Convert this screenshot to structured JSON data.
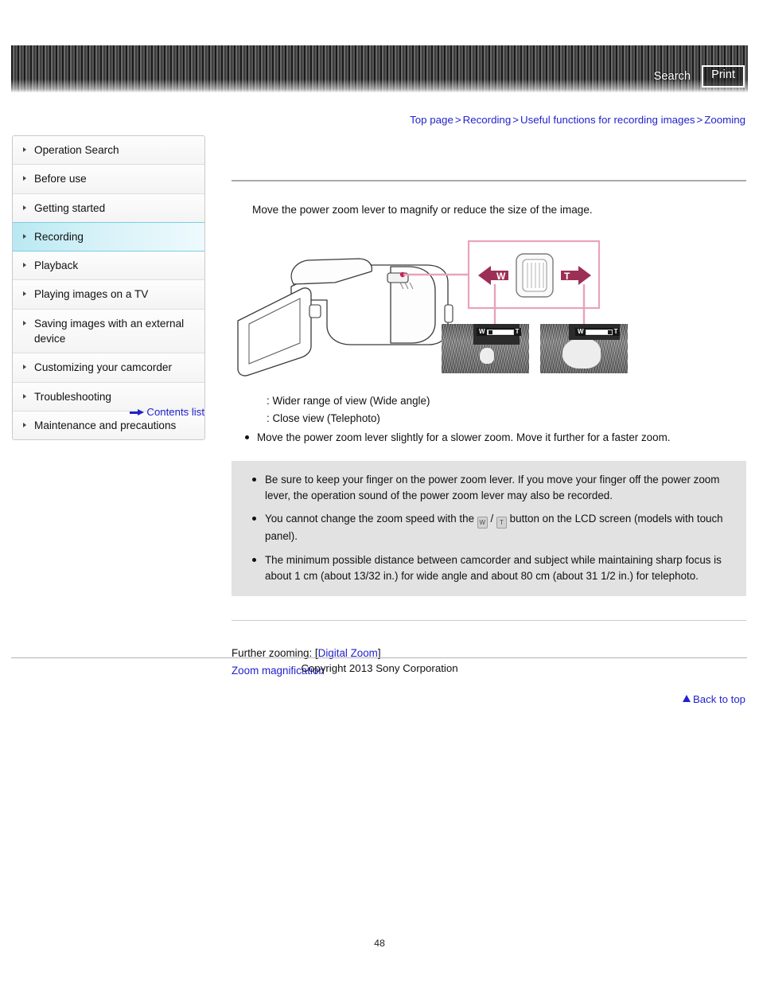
{
  "header": {
    "search_label": "Search",
    "print_label": "Print"
  },
  "breadcrumb": {
    "items": [
      "Top page",
      "Recording",
      "Useful functions for recording images",
      "Zooming"
    ],
    "separator": ">"
  },
  "sidebar": {
    "items": [
      {
        "label": "Operation Search",
        "active": false
      },
      {
        "label": "Before use",
        "active": false
      },
      {
        "label": "Getting started",
        "active": false
      },
      {
        "label": "Recording",
        "active": true
      },
      {
        "label": "Playback",
        "active": false
      },
      {
        "label": "Playing images on a TV",
        "active": false
      },
      {
        "label": "Saving images with an external device",
        "active": false
      },
      {
        "label": "Customizing your camcorder",
        "active": false
      },
      {
        "label": "Troubleshooting",
        "active": false
      },
      {
        "label": "Maintenance and precautions",
        "active": false
      }
    ],
    "contents_list_label": "Contents list"
  },
  "main": {
    "intro": "Move the power zoom lever to magnify or reduce the size of the image.",
    "figure": {
      "lever_left_label": "W",
      "lever_right_label": "T",
      "photo_left": {
        "w_label": "W",
        "t_label": "T"
      },
      "photo_right": {
        "w_label": "W",
        "t_label": "T"
      }
    },
    "legend": [
      ": Wider range of view (Wide angle)",
      ": Close view (Telephoto)"
    ],
    "tip": "Move the power zoom lever slightly for a slower zoom. Move it further for a faster zoom.",
    "notes": [
      {
        "text_before": "Be sure to keep your finger on the power zoom lever. If you move your finger off the power zoom lever, the operation sound of the power zoom lever may also be recorded.",
        "has_icons": false
      },
      {
        "text_before": "You cannot change the zoom speed with the ",
        "icon_a": "W",
        "between": " / ",
        "icon_b": "T",
        "text_after": " button on the LCD screen (models with touch panel).",
        "has_icons": true
      },
      {
        "text_before": "The minimum possible distance between camcorder and subject while maintaining sharp focus is about 1 cm (about 13/32 in.) for wide angle and about 80 cm (about 31 1/2 in.) for telephoto.",
        "has_icons": false
      }
    ],
    "further": {
      "prefix": "Further zooming: [",
      "link_label": "Digital Zoom",
      "suffix": "]",
      "second_link": "Zoom magnification"
    },
    "back_to_top_label": "Back to top"
  },
  "footer": {
    "copyright": "Copyright 2013 Sony Corporation",
    "page_number": "48"
  },
  "colors": {
    "link": "#2222cc",
    "accent_pink": "#e8a3bd",
    "accent_magenta": "#9c2f55",
    "active_sidebar": "#b9e8f2",
    "note_bg": "#e2e2e2"
  }
}
